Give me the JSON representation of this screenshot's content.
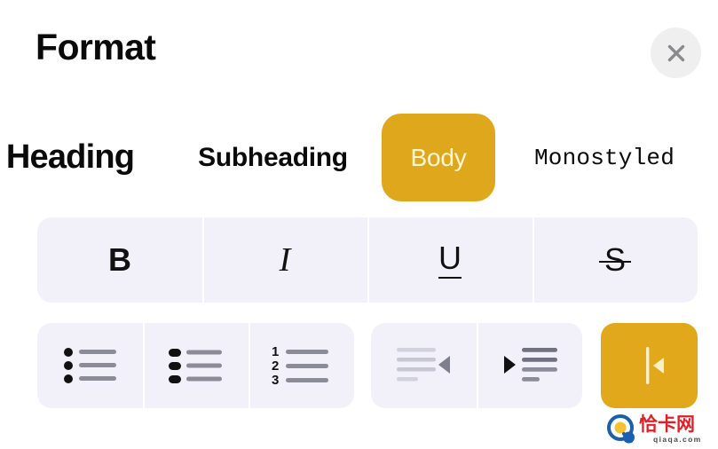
{
  "header": {
    "title": "Format",
    "close_label": "Close",
    "close_icon": "close-icon"
  },
  "style_row": {
    "options": [
      {
        "label": "Heading",
        "selected": false,
        "icon": "heading-style"
      },
      {
        "label": "Subheading",
        "selected": false,
        "icon": "subheading-style"
      },
      {
        "label": "Body",
        "selected": true,
        "icon": "body-style"
      },
      {
        "label": "Monostyled",
        "selected": false,
        "icon": "monostyled-style"
      }
    ]
  },
  "character_row": {
    "options": [
      {
        "label": "B",
        "name": "bold",
        "selected": false
      },
      {
        "label": "I",
        "name": "italic",
        "selected": false
      },
      {
        "label": "U",
        "name": "underline",
        "selected": false
      },
      {
        "label": "S",
        "name": "strikethrough",
        "selected": false
      }
    ]
  },
  "list_row": {
    "options": [
      {
        "label": "Bulleted List",
        "icon": "bulleted-list-icon",
        "selected": false
      },
      {
        "label": "Dashed List",
        "icon": "dashed-list-icon",
        "selected": false
      },
      {
        "label": "Numbered List",
        "icon": "numbered-list-icon",
        "selected": false,
        "numbers": [
          "1",
          "2",
          "3"
        ]
      }
    ]
  },
  "indent_row": {
    "options": [
      {
        "label": "Outdent",
        "icon": "outdent-icon",
        "selected": false,
        "enabled": false
      },
      {
        "label": "Indent",
        "icon": "indent-icon",
        "selected": false,
        "enabled": true
      }
    ]
  },
  "block_quote": {
    "label": "Block Quote",
    "icon": "block-quote-icon",
    "selected": true
  },
  "colors": {
    "accent_gold": "#DFA81C",
    "accent_gold_alt": "#E0A81A",
    "accent_gold_text": "#FDF5D8",
    "button_background": "#F2F1FA",
    "close_background": "#EFEFEF",
    "close_glyph": "#8A8A8E",
    "text_primary": "#0A0A0A",
    "icon_active": "#4A4A55",
    "icon_disabled": "#C9C9D6",
    "page_background": "#FFFFFF"
  },
  "watermark": {
    "brand_cn": "恰卡网",
    "url": "qiaqa.com"
  }
}
